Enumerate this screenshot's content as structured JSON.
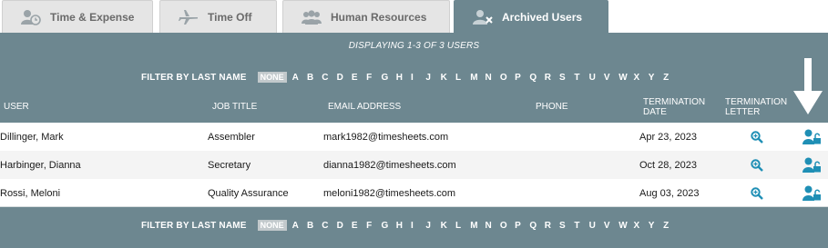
{
  "tabs": [
    {
      "label": "Time & Expense",
      "icon": "user-clock-icon"
    },
    {
      "label": "Time Off",
      "icon": "airplane-icon"
    },
    {
      "label": "Human Resources",
      "icon": "users-group-icon"
    },
    {
      "label": "Archived Users",
      "icon": "user-remove-icon",
      "active": true
    }
  ],
  "displaying": "DISPLAYING 1-3 OF 3 USERS",
  "filter": {
    "label": "FILTER BY LAST NAME",
    "none": "NONE",
    "letters": [
      "A",
      "B",
      "C",
      "D",
      "E",
      "F",
      "G",
      "H",
      "I",
      "J",
      "K",
      "L",
      "M",
      "N",
      "O",
      "P",
      "Q",
      "R",
      "S",
      "T",
      "U",
      "V",
      "W",
      "X",
      "Y",
      "Z"
    ]
  },
  "columns": {
    "user": "USER",
    "job_title": "JOB TITLE",
    "email": "EMAIL ADDRESS",
    "phone": "PHONE",
    "termination_date": "TERMINATION DATE",
    "termination_letter": "TERMINATION LETTER"
  },
  "rows": [
    {
      "user": "Dillinger, Mark",
      "job_title": "Assembler",
      "email": "mark1982@timesheets.com",
      "phone": "",
      "termination_date": "Apr 23, 2023"
    },
    {
      "user": "Harbinger, Dianna",
      "job_title": "Secretary",
      "email": "dianna1982@timesheets.com",
      "phone": "",
      "termination_date": "Oct 28, 2023"
    },
    {
      "user": "Rossi, Meloni",
      "job_title": "Quality Assurance",
      "email": "meloni1982@timesheets.com",
      "phone": "",
      "termination_date": "Aug 03, 2023"
    }
  ],
  "colors": {
    "panel": "#6d8790",
    "icon_blue": "#1f8fb5",
    "tab_inactive": "#e5e5e5"
  },
  "icons": {
    "view_letter": "magnifier-plus-icon",
    "restore_user": "user-unlock-icon",
    "annotation": "down-arrow-icon"
  }
}
